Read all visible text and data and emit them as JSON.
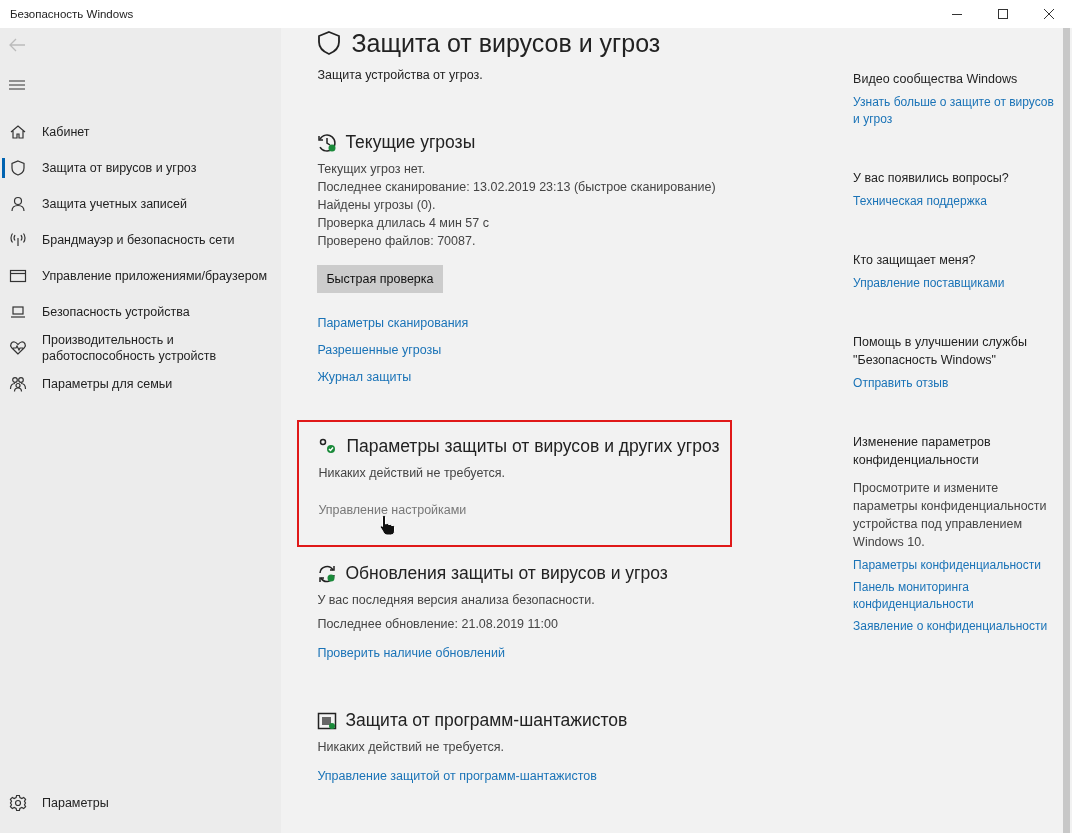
{
  "window": {
    "title": "Безопасность Windows"
  },
  "sidebar": {
    "items": [
      {
        "kind": "home",
        "label": "Кабинет",
        "selected": false
      },
      {
        "kind": "shield",
        "label": "Защита от вирусов и угроз",
        "selected": true
      },
      {
        "kind": "person",
        "label": "Защита учетных записей",
        "selected": false
      },
      {
        "kind": "antenna",
        "label": "Брандмауэр и безопасность сети",
        "selected": false
      },
      {
        "kind": "window",
        "label": "Управление приложениями/браузером",
        "selected": false
      },
      {
        "kind": "laptop",
        "label": "Безопасность устройства",
        "selected": false
      },
      {
        "kind": "heart",
        "label": "Производительность и работоспособность устройств",
        "selected": false
      },
      {
        "kind": "family",
        "label": "Параметры для семьи",
        "selected": false
      }
    ],
    "settings": {
      "label": "Параметры"
    }
  },
  "page": {
    "title": "Защита от вирусов и угроз",
    "subtitle": "Защита устройства от угроз."
  },
  "sections": [
    {
      "kind": "threats",
      "title": "Текущие угрозы",
      "lines": [
        "Текущих угроз нет.",
        "Последнее сканирование: 13.02.2019 23:13 (быстрое сканирование)",
        "Найдены угрозы (0).",
        "Проверка длилась 4 мин 57 с",
        "Проверено файлов: 70087."
      ],
      "button": "Быстрая проверка",
      "links": [
        {
          "label": "Параметры сканирования",
          "hovered": false
        },
        {
          "label": "Разрешенные угрозы",
          "hovered": false
        },
        {
          "label": "Журнал защиты",
          "hovered": false
        }
      ]
    },
    {
      "kind": "settings",
      "title": "Параметры защиты от вирусов и других угроз",
      "highlighted": true,
      "lines": [
        "Никаких действий не требуется."
      ],
      "links": [
        {
          "label": "Управление настройками",
          "hovered": true
        }
      ]
    },
    {
      "kind": "updates",
      "title": "Обновления защиты от вирусов и угроз",
      "lines": [
        "У вас последняя версия анализа безопасности.",
        "Последнее обновление: 21.08.2019 11:00"
      ],
      "links": [
        {
          "label": "Проверить наличие обновлений",
          "hovered": false
        }
      ]
    },
    {
      "kind": "ransomware",
      "title": "Защита от программ-шантажистов",
      "lines": [
        "Никаких действий не требуется."
      ],
      "links": [
        {
          "label": "Управление защитой от программ-шантажистов",
          "hovered": false
        }
      ]
    }
  ],
  "aside": [
    {
      "heading": "Видео сообщества Windows",
      "links": [
        "Узнать больше о защите от вирусов и угроз"
      ]
    },
    {
      "heading": "У вас появились вопросы?",
      "links": [
        "Техническая поддержка"
      ]
    },
    {
      "heading": "Кто защищает меня?",
      "links": [
        "Управление поставщиками"
      ]
    },
    {
      "heading": "Помощь в улучшении службы \"Безопасность Windows\"",
      "links": [
        "Отправить отзыв"
      ]
    },
    {
      "heading": "Изменение параметров конфиденциальности",
      "description": "Просмотрите и измените параметры конфиденциальности устройства под управлением Windows 10.",
      "links": [
        "Параметры конфиденциальности",
        "Панель мониторинга конфиденциальности",
        "Заявление о конфиденциальности"
      ]
    }
  ]
}
